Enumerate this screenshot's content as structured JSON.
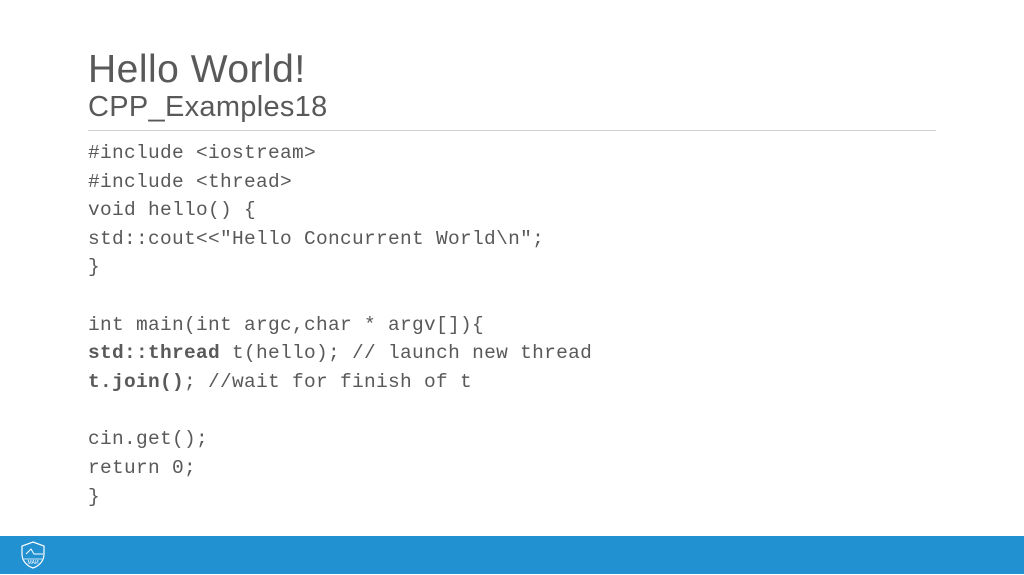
{
  "header": {
    "title": "Hello World!",
    "subtitle": "CPP_Examples18"
  },
  "code": {
    "lines": [
      {
        "text": "#include <iostream>",
        "bold": false
      },
      {
        "text": "#include <thread>",
        "bold": false
      },
      {
        "text": "void hello() {",
        "bold": false
      },
      {
        "text": "std::cout<<\"Hello Concurrent World\\n\";",
        "bold": false
      },
      {
        "text": "}",
        "bold": false
      },
      {
        "text": "",
        "bold": false
      },
      {
        "text": "int main(int argc,char * argv[]){",
        "bold": false
      },
      {
        "prefix": "std::thread",
        "rest": " t(hello); // launch new thread",
        "boldPrefix": true
      },
      {
        "prefix": "t.join()",
        "rest": "; //wait for finish of t",
        "boldPrefix": true
      },
      {
        "text": "",
        "bold": false
      },
      {
        "text": "cin.get();",
        "bold": false
      },
      {
        "text": "return 0;",
        "bold": false
      },
      {
        "text": "}",
        "bold": false
      }
    ]
  },
  "footer": {
    "logoName": "mai-shield-logo"
  }
}
